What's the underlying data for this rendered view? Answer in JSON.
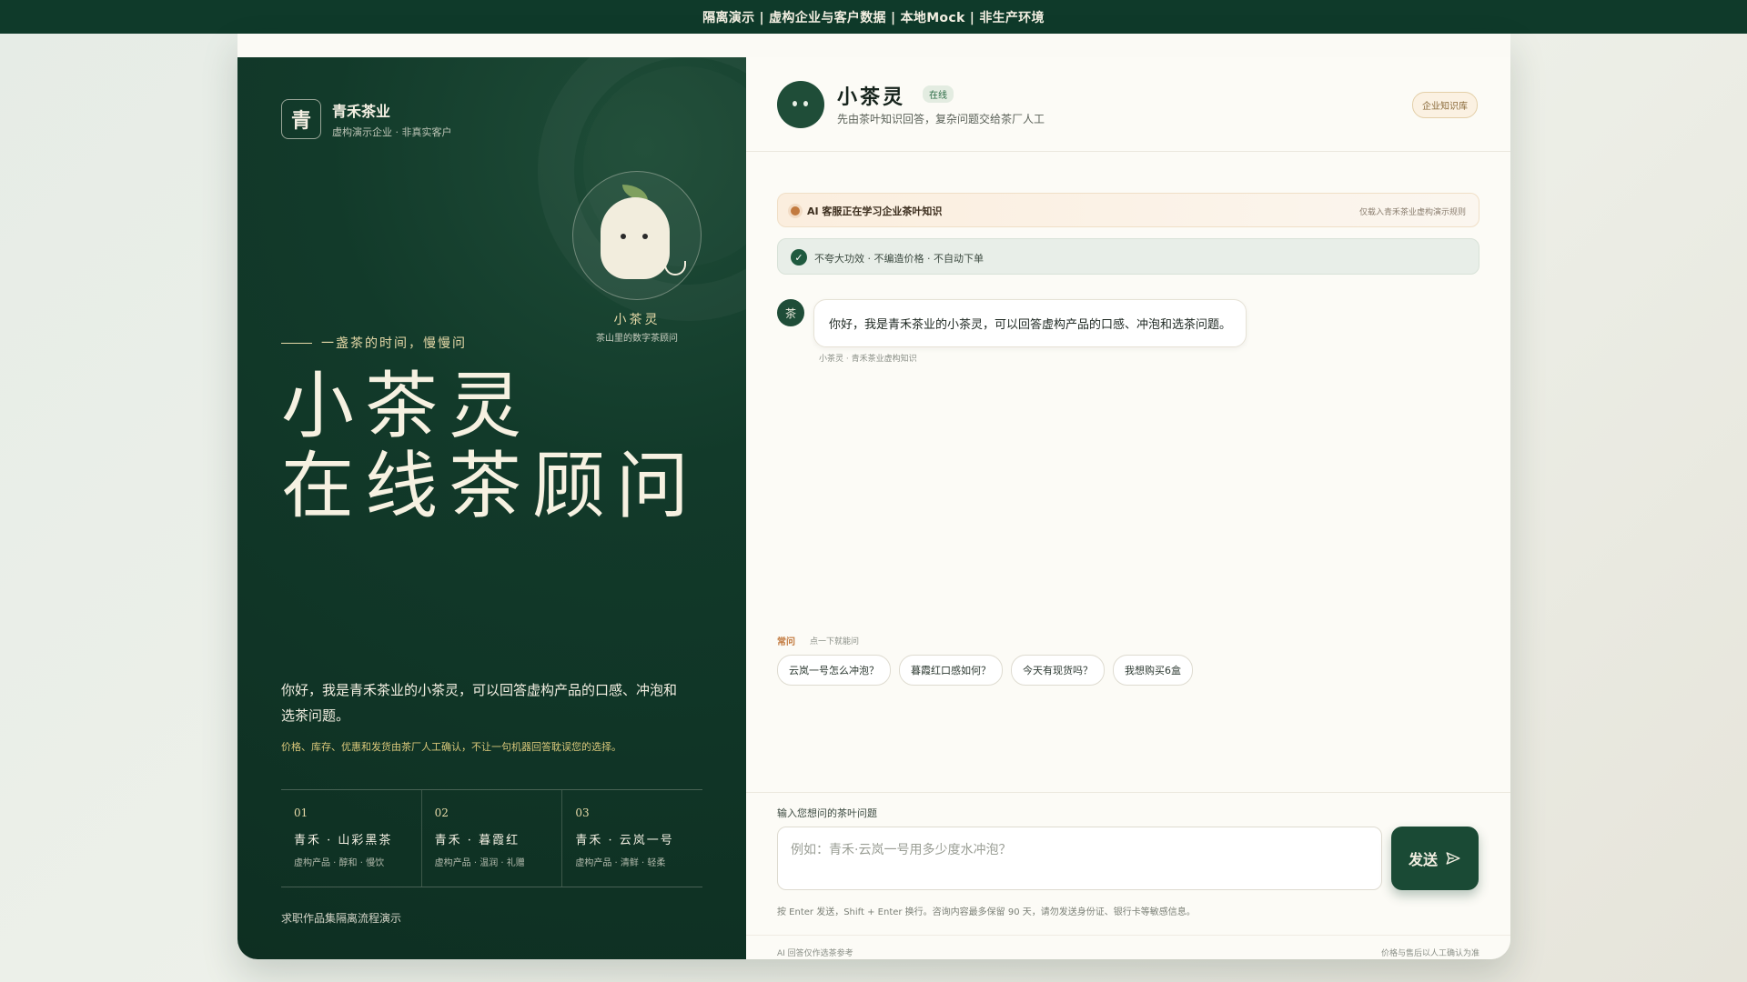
{
  "banner": {
    "text": "隔离演示 | 虚构企业与客户数据 | 本地Mock | 非生产环境"
  },
  "brand": {
    "logo_char": "青",
    "name": "青禾茶业",
    "sub": "虚构演示企业 · 非真实客户"
  },
  "mascot": {
    "name": "小茶灵",
    "sub": "茶山里的数字茶顾问"
  },
  "hero": {
    "tagline": "一盏茶的时间，慢慢问",
    "title_line1": "小茶灵",
    "title_line2": "在线茶顾问",
    "intro": "你好，我是青禾茶业的小茶灵，可以回答虚构产品的口感、冲泡和选茶问题。",
    "note": "价格、库存、优惠和发货由茶厂人工确认，不让一句机器回答耽误您的选择。"
  },
  "products": [
    {
      "num": "01",
      "name": "青禾 · 山彩黑茶",
      "desc": "虚构产品 · 醇和 · 慢饮"
    },
    {
      "num": "02",
      "name": "青禾 · 暮霞红",
      "desc": "虚构产品 · 温润 · 礼赠"
    },
    {
      "num": "03",
      "name": "青禾 · 云岚一号",
      "desc": "虚构产品 · 清鲜 · 轻柔"
    }
  ],
  "left_footer": "求职作品集隔离流程演示",
  "chat": {
    "bot_name": "小茶灵",
    "status": "在线",
    "bot_sub": "先由茶叶知识回答，复杂问题交给茶厂人工",
    "kb_button": "企业知识库",
    "learning": {
      "text": "AI 客服正在学习企业茶叶知识",
      "right": "仅载入青禾茶业虚构演示规则"
    },
    "rules": "不夸大功效 · 不编造价格 · 不自动下单",
    "message": {
      "avatar_char": "茶",
      "text": "你好，我是青禾茶业的小茶灵，可以回答虚构产品的口感、冲泡和选茶问题。",
      "meta": "小茶灵 · 青禾茶业虚构知识"
    },
    "faq": {
      "title": "常问",
      "sub": "点一下就能问",
      "items": [
        "云岚一号怎么冲泡？",
        "暮霞红口感如何？",
        "今天有现货吗？",
        "我想购买6盒"
      ]
    },
    "input": {
      "label": "输入您想问的茶叶问题",
      "placeholder": "例如：青禾·云岚一号用多少度水冲泡？",
      "send": "发送",
      "hint": "按 Enter 发送，Shift + Enter 换行。咨询内容最多保留 90 天，请勿发送身份证、银行卡等敏感信息。"
    },
    "footer": {
      "left": "AI 回答仅作选茶参考",
      "right": "价格与售后以人工确认为准"
    }
  },
  "colors": {
    "primary": "#123a2a",
    "accent": "#e6d9a8",
    "send": "#1a4a35"
  }
}
